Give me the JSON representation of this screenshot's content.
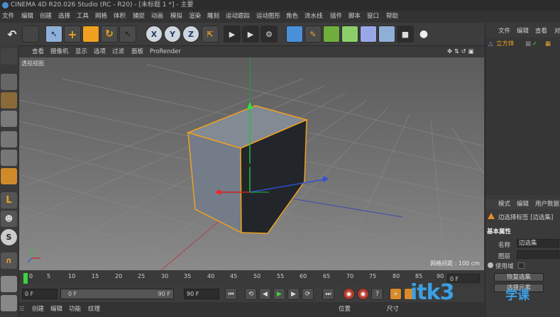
{
  "app": {
    "title": "CINEMA 4D R20.026 Studio (RC - R20) - [未标题 1 *] - 主要"
  },
  "menubar": {
    "items": [
      "文件",
      "编辑",
      "创建",
      "选择",
      "工具",
      "网格",
      "体积",
      "捕捉",
      "动画",
      "模拟",
      "渲染",
      "雕刻",
      "运动跟踪",
      "运动图形",
      "角色",
      "流水线",
      "插件",
      "脚本",
      "窗口",
      "帮助"
    ]
  },
  "toolbar": {
    "x_label": "X",
    "y_label": "Y",
    "z_label": "Z"
  },
  "viewport": {
    "menu": [
      "查看",
      "摄像机",
      "显示",
      "选项",
      "过滤",
      "面板",
      "ProRender"
    ],
    "label": "透视视图",
    "scale": "网格间距 : 100 cm"
  },
  "timeline": {
    "ticks": [
      "0",
      "5",
      "10",
      "15",
      "20",
      "25",
      "30",
      "35",
      "40",
      "45",
      "50",
      "55",
      "60",
      "65",
      "70",
      "75",
      "80",
      "85",
      "90"
    ],
    "end_frame": "0 F"
  },
  "playback": {
    "start": "0 F",
    "range_left": "0 F",
    "range_right": "90 F",
    "end": "90 F"
  },
  "bottom_tabs": {
    "items": [
      "创建",
      "编辑",
      "功能",
      "纹理"
    ],
    "coord_label": "位置",
    "size_label": "尺寸"
  },
  "object_manager": {
    "menu": [
      "文件",
      "编辑",
      "查看",
      "对"
    ],
    "object_name": "立方体"
  },
  "attributes": {
    "tabs": [
      "模式",
      "编辑",
      "用户数据"
    ],
    "header": "边选择标签 [边选集]",
    "section": "基本属性",
    "name_label": "名称",
    "name_value": "边选集",
    "layer_label": "图层",
    "use_label": "使用域",
    "btn_restore": "恢复选集",
    "btn_select": "选择元素"
  },
  "watermark": {
    "main": "itk3",
    "sub": "学课"
  },
  "colors": {
    "accent": "#3ed33e",
    "selection": "#f0a020",
    "axis_x": "#d02020",
    "axis_y": "#20c020",
    "axis_z": "#3050d0"
  }
}
